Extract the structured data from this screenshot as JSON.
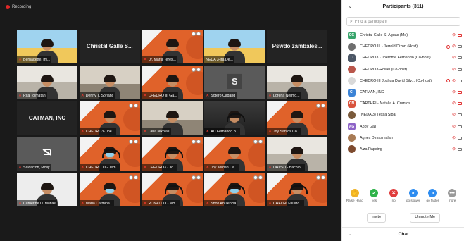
{
  "recording": {
    "label": "Recording"
  },
  "gallery": [
    {
      "name": "Bernadette, Ini...",
      "style": "blue",
      "person": true,
      "muted": true
    },
    {
      "name": "Christal Galle S...",
      "style": "name-only",
      "big": true
    },
    {
      "name": "Dr. Maria Teres...",
      "style": "orange",
      "person": true,
      "muted": true,
      "logos": true
    },
    {
      "name": "NEDA 3-Ira De...",
      "style": "blue",
      "person": true,
      "muted": false
    },
    {
      "name": "Pswdo zambales...",
      "style": "name-only",
      "big": true
    },
    {
      "name": "Rita Tolmatan",
      "style": "room2",
      "person": true,
      "muted": true
    },
    {
      "name": "Denny T. Soriano",
      "style": "room",
      "person": true,
      "muted": true
    },
    {
      "name": "CHEDRO III Ga...",
      "style": "orange",
      "person": true,
      "muted": true,
      "logos": true
    },
    {
      "name": "Sotero Cagang",
      "style": "grey",
      "avatar": "S",
      "muted": true
    },
    {
      "name": "Lorena Nermo...",
      "style": "room2",
      "person": true,
      "muted": true
    },
    {
      "name": "CATMAN, INC",
      "style": "name-only",
      "big": true
    },
    {
      "name": "CHEDRO3- Joe...",
      "style": "orange",
      "person": true,
      "muted": true,
      "logos": true
    },
    {
      "name": "Lana Nikolas",
      "style": "room",
      "person": true,
      "muted": true
    },
    {
      "name": "AU Fernando B...",
      "style": "dark",
      "person": true,
      "headset": true,
      "muted": true
    },
    {
      "name": "Joy Santos Co...",
      "style": "orange",
      "person": true,
      "muted": true,
      "logos": true
    },
    {
      "name": "Salcacion, Molly",
      "style": "grey",
      "camoff": true,
      "muted": true
    },
    {
      "name": "CHEDRO III - Jem...",
      "style": "orange",
      "person": true,
      "mask": true,
      "headset": true,
      "muted": true,
      "logos": true
    },
    {
      "name": "CHEDRO3 - Jo...",
      "style": "orange",
      "person": true,
      "headset": true,
      "muted": true,
      "logos": true
    },
    {
      "name": "Joy Jordan Ca...",
      "style": "orange",
      "person": true,
      "muted": true,
      "logos": true
    },
    {
      "name": "DHVSU - Bacolo...",
      "style": "room2",
      "person": true,
      "muted": true
    },
    {
      "name": "Catherine D. Matias",
      "style": "white",
      "person": true,
      "muted": true
    },
    {
      "name": "Maria Carmina...",
      "style": "orange",
      "person": true,
      "mask": true,
      "muted": true,
      "logos": true
    },
    {
      "name": "RONALDO - MB...",
      "style": "orange",
      "person": true,
      "headset": true,
      "muted": true,
      "logos": true
    },
    {
      "name": "Shon Abulencia",
      "style": "orange",
      "person": true,
      "headset": true,
      "mask": true,
      "muted": true,
      "logos": true
    },
    {
      "name": "CHEDRO-III Mo...",
      "style": "orange",
      "person": true,
      "headset": true,
      "muted": true,
      "logos": true
    }
  ],
  "panel": {
    "title": "Participants (311)",
    "search_placeholder": "Find a participant",
    "participants": [
      {
        "initials": "CG",
        "color": "#37a46b",
        "name": "Christal Galle S. Aguas (Me)",
        "mic": "muted",
        "cam": "red"
      },
      {
        "initials": "",
        "color": "#6e6e6e",
        "photo": true,
        "name": "CHEDRO III - Jerrold Dizon (Host)",
        "mic": "muted",
        "cam": "grey",
        "share": true
      },
      {
        "initials": "C",
        "color": "#4c5766",
        "name": "CHEDRO3 - Jherome Fernando (Co-host)",
        "mic": "muted",
        "cam": "grey"
      },
      {
        "initials": "",
        "color": "#b9564b",
        "photo": true,
        "name": "CHEDRO3-Rowel (Co-host)",
        "mic": "muted",
        "cam": "grey"
      },
      {
        "initials": "",
        "color": "#d9d9d9",
        "photo": true,
        "name": "CHEDRO-III Joshua David Silv... (Co-host)",
        "mic": "muted",
        "cam": "grey",
        "share": true
      },
      {
        "initials": "CI",
        "color": "#3b83d6",
        "name": "CATMAN, INC",
        "mic": "muted",
        "cam": "red"
      },
      {
        "initials": "CN",
        "color": "#d9533d",
        "name": "CARTHPI - Natalia A. Crantos",
        "mic": "muted",
        "cam": "red"
      },
      {
        "initials": "",
        "color": "#7a5a3b",
        "photo": true,
        "name": "(NEDA 3) Tessa Sibal",
        "mic": "muted",
        "cam": "grey"
      },
      {
        "initials": "AG",
        "color": "#8d63c7",
        "name": "Abby Gail",
        "mic": "muted",
        "cam": "grey"
      },
      {
        "initials": "",
        "color": "#a87b55",
        "photo": true,
        "name": "Agnes Dimasmalan",
        "mic": "muted",
        "cam": "grey"
      },
      {
        "initials": "",
        "color": "#7e4b2f",
        "photo": true,
        "name": "Aiza Rapsing",
        "mic": "muted",
        "cam": "grey"
      }
    ],
    "reactions": [
      {
        "label": "Raise Hand",
        "glyph": "✋",
        "color": "#f0b429"
      },
      {
        "label": "yes",
        "glyph": "✓",
        "color": "#2fb34a"
      },
      {
        "label": "no",
        "glyph": "✕",
        "color": "#e03c3c"
      },
      {
        "label": "go slower",
        "glyph": "«",
        "color": "#2d8cf0"
      },
      {
        "label": "go faster",
        "glyph": "»",
        "color": "#2d8cf0"
      },
      {
        "label": "more",
        "glyph": "•••",
        "color": "#9a9a9a"
      }
    ],
    "invite_label": "Invite",
    "unmute_label": "Unmute Me",
    "chat_title": "Chat"
  }
}
